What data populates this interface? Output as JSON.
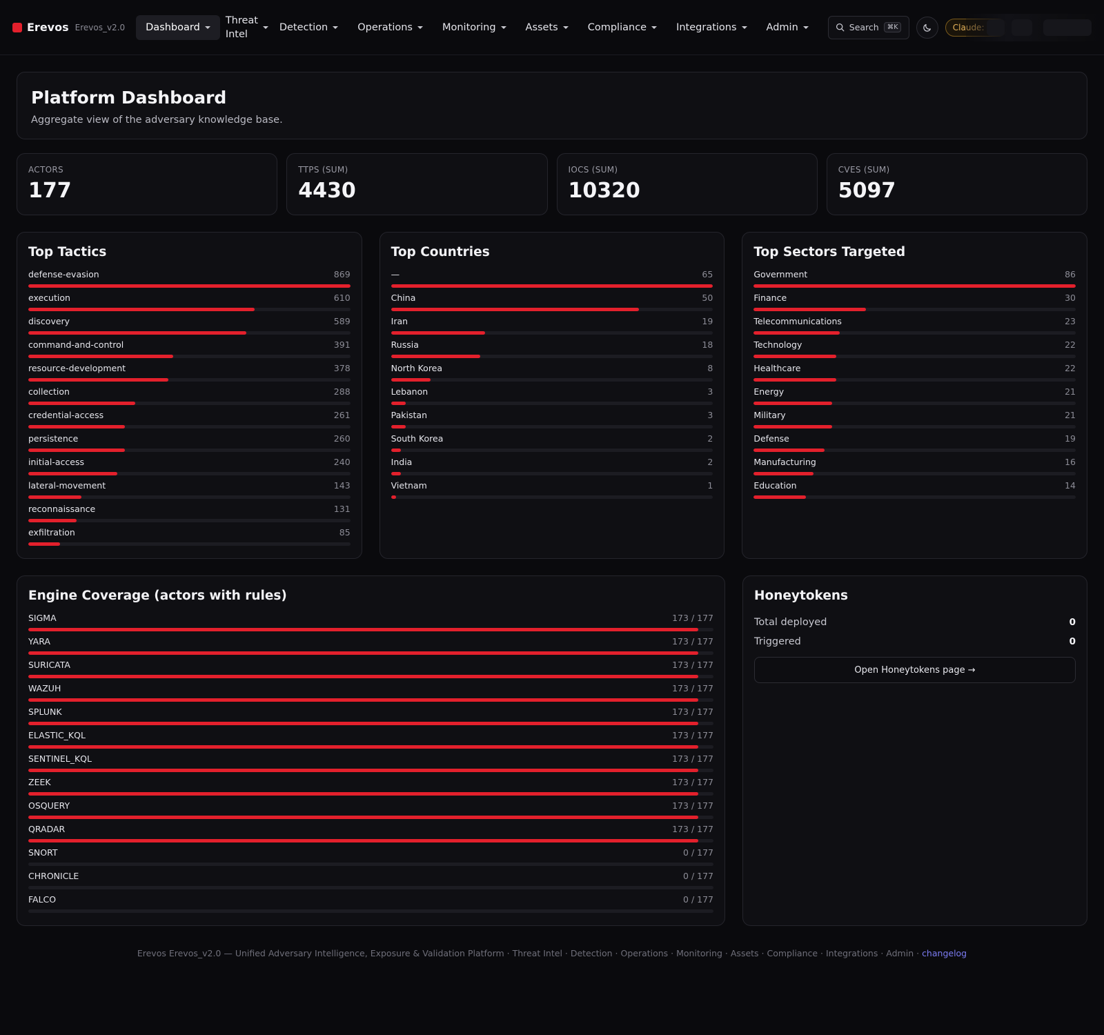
{
  "brand": {
    "name": "Erevos",
    "version": "Erevos_v2.0"
  },
  "nav": {
    "items": [
      {
        "label": "Dashboard",
        "active": true,
        "twoLine": false
      },
      {
        "label": "Threat Intel",
        "active": false,
        "twoLine": true
      },
      {
        "label": "Detection",
        "active": false,
        "twoLine": false
      },
      {
        "label": "Operations",
        "active": false,
        "twoLine": false
      },
      {
        "label": "Monitoring",
        "active": false,
        "twoLine": false
      },
      {
        "label": "Assets",
        "active": false,
        "twoLine": false
      },
      {
        "label": "Compliance",
        "active": false,
        "twoLine": false
      },
      {
        "label": "Integrations",
        "active": false,
        "twoLine": false
      },
      {
        "label": "Admin",
        "active": false,
        "twoLine": false
      }
    ],
    "search_label": "Search",
    "search_shortcut": "⌘K",
    "theme_icon": "moon-icon",
    "claude_status": "Claude: offl"
  },
  "header": {
    "title": "Platform Dashboard",
    "subtitle": "Aggregate view of the adversary knowledge base."
  },
  "stats": [
    {
      "label": "ACTORS",
      "value": "177"
    },
    {
      "label": "TTPS (SUM)",
      "value": "4430"
    },
    {
      "label": "IOCS (SUM)",
      "value": "10320"
    },
    {
      "label": "CVES (SUM)",
      "value": "5097"
    }
  ],
  "accent_color": "#e3202c",
  "panels": {
    "tactics": {
      "title": "Top Tactics",
      "items": [
        {
          "name": "defense-evasion",
          "count": 869
        },
        {
          "name": "execution",
          "count": 610
        },
        {
          "name": "discovery",
          "count": 589
        },
        {
          "name": "command-and-control",
          "count": 391
        },
        {
          "name": "resource-development",
          "count": 378
        },
        {
          "name": "collection",
          "count": 288
        },
        {
          "name": "credential-access",
          "count": 261
        },
        {
          "name": "persistence",
          "count": 260
        },
        {
          "name": "initial-access",
          "count": 240
        },
        {
          "name": "lateral-movement",
          "count": 143
        },
        {
          "name": "reconnaissance",
          "count": 131
        },
        {
          "name": "exfiltration",
          "count": 85
        }
      ]
    },
    "countries": {
      "title": "Top Countries",
      "items": [
        {
          "name": "—",
          "count": 65
        },
        {
          "name": "China",
          "count": 50
        },
        {
          "name": "Iran",
          "count": 19
        },
        {
          "name": "Russia",
          "count": 18
        },
        {
          "name": "North Korea",
          "count": 8
        },
        {
          "name": "Lebanon",
          "count": 3
        },
        {
          "name": "Pakistan",
          "count": 3
        },
        {
          "name": "South Korea",
          "count": 2
        },
        {
          "name": "India",
          "count": 2
        },
        {
          "name": "Vietnam",
          "count": 1
        }
      ]
    },
    "sectors": {
      "title": "Top Sectors Targeted",
      "items": [
        {
          "name": "Government",
          "count": 86
        },
        {
          "name": "Finance",
          "count": 30
        },
        {
          "name": "Telecommunications",
          "count": 23
        },
        {
          "name": "Technology",
          "count": 22
        },
        {
          "name": "Healthcare",
          "count": 22
        },
        {
          "name": "Energy",
          "count": 21
        },
        {
          "name": "Military",
          "count": 21
        },
        {
          "name": "Defense",
          "count": 19
        },
        {
          "name": "Manufacturing",
          "count": 16
        },
        {
          "name": "Education",
          "count": 14
        }
      ]
    },
    "engines": {
      "title": "Engine Coverage (actors with rules)",
      "total": 177,
      "items": [
        {
          "name": "SIGMA",
          "count": 173
        },
        {
          "name": "YARA",
          "count": 173
        },
        {
          "name": "SURICATA",
          "count": 173
        },
        {
          "name": "WAZUH",
          "count": 173
        },
        {
          "name": "SPLUNK",
          "count": 173
        },
        {
          "name": "ELASTIC_KQL",
          "count": 173
        },
        {
          "name": "SENTINEL_KQL",
          "count": 173
        },
        {
          "name": "ZEEK",
          "count": 173
        },
        {
          "name": "OSQUERY",
          "count": 173
        },
        {
          "name": "QRADAR",
          "count": 173
        },
        {
          "name": "SNORT",
          "count": 0
        },
        {
          "name": "CHRONICLE",
          "count": 0
        },
        {
          "name": "FALCO",
          "count": 0
        }
      ]
    },
    "honeytokens": {
      "title": "Honeytokens",
      "rows": [
        {
          "label": "Total deployed",
          "value": "0"
        },
        {
          "label": "Triggered",
          "value": "0"
        }
      ],
      "button_label": "Open Honeytokens page →"
    }
  },
  "footer": {
    "text": "Erevos Erevos_v2.0 — Unified Adversary Intelligence, Exposure & Validation Platform · Threat Intel · Detection · Operations · Monitoring · Assets · Compliance · Integrations · Admin · ",
    "link_label": "changelog"
  }
}
